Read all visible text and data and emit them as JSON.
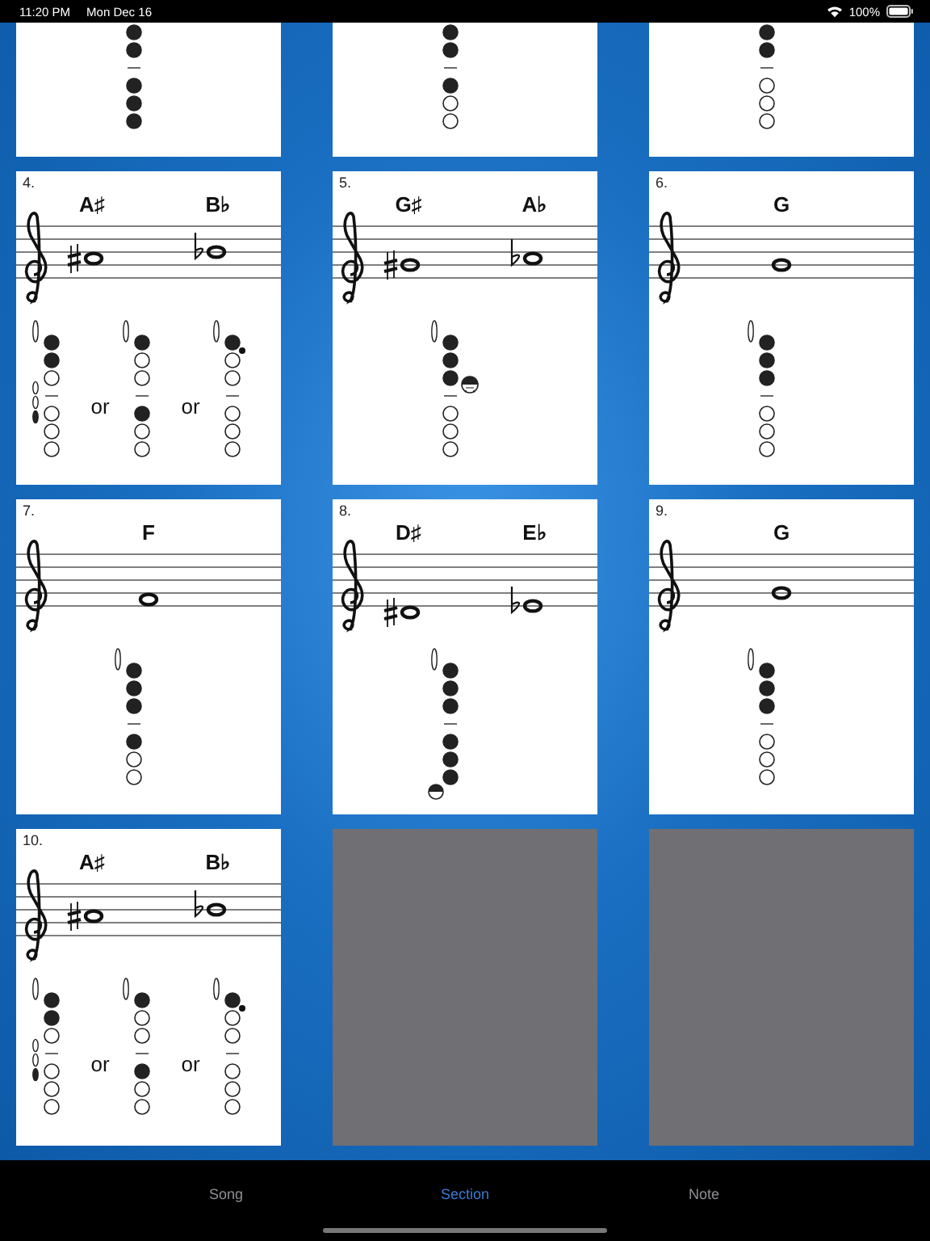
{
  "status_bar": {
    "time": "11:20 PM",
    "date": "Mon Dec 16",
    "battery": "100%"
  },
  "top_row": [
    {
      "fingering": {
        "holes": [
          true,
          true,
          true,
          true,
          true
        ]
      }
    },
    {
      "fingering": {
        "holes": [
          true,
          true,
          true,
          false,
          false
        ]
      }
    },
    {
      "fingering": {
        "holes": [
          true,
          true,
          false,
          false,
          false
        ]
      }
    }
  ],
  "cards": [
    {
      "number": "4.",
      "notes": [
        {
          "name": "A♯",
          "kind": "a-sharp"
        },
        {
          "name": "B♭",
          "kind": "b-flat"
        }
      ],
      "fingerings": [
        {
          "kind": "plain",
          "thumb": true,
          "holes": [
            true,
            true,
            false,
            false,
            false,
            false
          ],
          "side_keys": [
            false,
            false,
            true
          ]
        },
        {
          "lead": "or",
          "kind": "plain",
          "thumb": true,
          "holes": [
            true,
            false,
            false,
            true,
            false,
            false
          ]
        },
        {
          "lead": "or",
          "kind": "dot",
          "thumb": true,
          "holes": [
            true,
            false,
            false,
            false,
            false,
            false
          ]
        }
      ]
    },
    {
      "number": "5.",
      "notes": [
        {
          "name": "G♯",
          "kind": "g-sharp"
        },
        {
          "name": "A♭",
          "kind": "a-flat"
        }
      ],
      "fingerings": [
        {
          "kind": "side",
          "thumb": true,
          "holes": [
            true,
            true,
            true,
            false,
            false,
            false
          ]
        }
      ]
    },
    {
      "number": "6.",
      "notes": [
        {
          "name": "G",
          "kind": "g"
        }
      ],
      "fingerings": [
        {
          "kind": "plain",
          "thumb": true,
          "holes": [
            true,
            true,
            true,
            false,
            false,
            false
          ]
        }
      ]
    },
    {
      "number": "7.",
      "notes": [
        {
          "name": "F",
          "kind": "f"
        }
      ],
      "fingerings": [
        {
          "kind": "plain",
          "thumb": true,
          "holes": [
            true,
            true,
            true,
            true,
            false,
            false
          ]
        }
      ]
    },
    {
      "number": "8.",
      "notes": [
        {
          "name": "D♯",
          "kind": "d-sharp"
        },
        {
          "name": "E♭",
          "kind": "e-flat"
        }
      ],
      "fingerings": [
        {
          "kind": "low",
          "thumb": true,
          "holes": [
            true,
            true,
            true,
            true,
            true,
            true
          ]
        }
      ]
    },
    {
      "number": "9.",
      "notes": [
        {
          "name": "G",
          "kind": "g"
        }
      ],
      "fingerings": [
        {
          "kind": "plain",
          "thumb": true,
          "holes": [
            true,
            true,
            true,
            false,
            false,
            false
          ]
        }
      ]
    },
    {
      "number": "10.",
      "notes": [
        {
          "name": "A♯",
          "kind": "a-sharp"
        },
        {
          "name": "B♭",
          "kind": "b-flat"
        }
      ],
      "fingerings": [
        {
          "kind": "plain",
          "thumb": true,
          "holes": [
            true,
            true,
            false,
            false,
            false,
            false
          ],
          "side_keys": [
            false,
            false,
            true
          ]
        },
        {
          "lead": "or",
          "kind": "plain",
          "thumb": true,
          "holes": [
            true,
            false,
            false,
            true,
            false,
            false
          ]
        },
        {
          "lead": "or",
          "kind": "dot",
          "thumb": true,
          "holes": [
            true,
            false,
            false,
            false,
            false,
            false
          ]
        }
      ]
    }
  ],
  "empty_slots": [
    {
      "kind": "empty"
    },
    {
      "kind": "empty"
    }
  ],
  "tabs": [
    {
      "label": "Song",
      "selected": false
    },
    {
      "label": "Section",
      "selected": true
    },
    {
      "label": "Note",
      "selected": false
    }
  ]
}
